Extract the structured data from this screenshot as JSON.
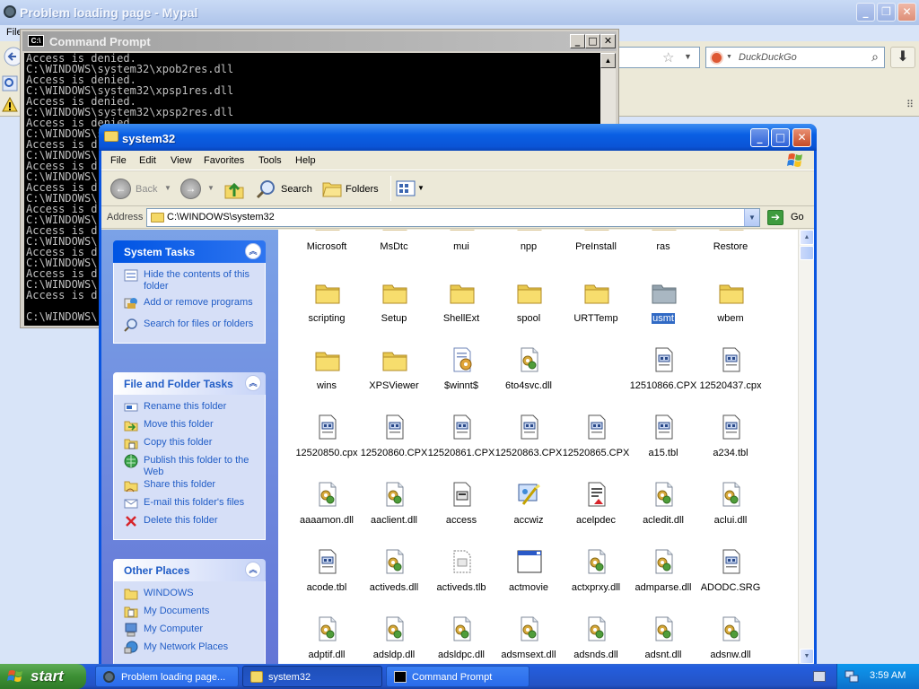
{
  "browser": {
    "title": "Problem loading page - Mypal",
    "menu_first": "File",
    "search_placeholder": "DuckDuckGo"
  },
  "cmd": {
    "title": "Command Prompt",
    "lines": [
      "Access is denied.",
      "C:\\WINDOWS\\system32\\xpob2res.dll",
      "Access is denied.",
      "C:\\WINDOWS\\system32\\xpsp1res.dll",
      "Access is denied.",
      "C:\\WINDOWS\\system32\\xpsp2res.dll",
      "Access is denied.",
      "C:\\WINDOWS\\system32\\",
      "Access is d",
      "C:\\WINDOWS\\",
      "Access is d",
      "C:\\WINDOWS\\",
      "Access is d",
      "C:\\WINDOWS\\",
      "Access is d",
      "C:\\WINDOWS\\",
      "Access is d",
      "C:\\WINDOWS\\",
      "Access is d",
      "C:\\WINDOWS\\",
      "Access is d",
      "C:\\WINDOWS\\",
      "Access is d",
      "",
      "C:\\WINDOWS\\"
    ]
  },
  "explorer": {
    "title": "system32",
    "menu": [
      "File",
      "Edit",
      "View",
      "Favorites",
      "Tools",
      "Help"
    ],
    "toolbar": {
      "back": "Back",
      "search": "Search",
      "folders": "Folders"
    },
    "address_label": "Address",
    "address_value": "C:\\WINDOWS\\system32",
    "go_label": "Go",
    "panels": {
      "system_tasks": {
        "title": "System Tasks",
        "items": [
          "Hide the contents of this folder",
          "Add or remove programs",
          "Search for files or folders"
        ]
      },
      "file_folder_tasks": {
        "title": "File and Folder Tasks",
        "items": [
          "Rename this folder",
          "Move this folder",
          "Copy this folder",
          "Publish this folder to the Web",
          "Share this folder",
          "E-mail this folder's files",
          "Delete this folder"
        ]
      },
      "other_places": {
        "title": "Other Places",
        "items": [
          "WINDOWS",
          "My Documents",
          "My Computer",
          "My Network Places"
        ]
      }
    },
    "files": [
      {
        "name": "Microsoft",
        "icon": "folder"
      },
      {
        "name": "MsDtc",
        "icon": "folder"
      },
      {
        "name": "mui",
        "icon": "folder"
      },
      {
        "name": "npp",
        "icon": "folder"
      },
      {
        "name": "PreInstall",
        "icon": "folder"
      },
      {
        "name": "ras",
        "icon": "folder"
      },
      {
        "name": "Restore",
        "icon": "folder"
      },
      {
        "name": "scripting",
        "icon": "folder"
      },
      {
        "name": "Setup",
        "icon": "folder"
      },
      {
        "name": "ShellExt",
        "icon": "folder"
      },
      {
        "name": "spool",
        "icon": "folder"
      },
      {
        "name": "URTTemp",
        "icon": "folder"
      },
      {
        "name": "usmt",
        "icon": "folder-hidden",
        "selected": true
      },
      {
        "name": "wbem",
        "icon": "folder"
      },
      {
        "name": "wins",
        "icon": "folder"
      },
      {
        "name": "XPSViewer",
        "icon": "folder"
      },
      {
        "name": "$winnt$",
        "icon": "config"
      },
      {
        "name": "6to4svc.dll",
        "icon": "dll"
      },
      {
        "name": "",
        "icon": "none"
      },
      {
        "name": "12510866.CPX",
        "icon": "cpx"
      },
      {
        "name": "12520437.cpx",
        "icon": "cpx"
      },
      {
        "name": "12520850.cpx",
        "icon": "cpx"
      },
      {
        "name": "12520860.CPX",
        "icon": "cpx"
      },
      {
        "name": "12520861.CPX",
        "icon": "cpx"
      },
      {
        "name": "12520863.CPX",
        "icon": "cpx"
      },
      {
        "name": "12520865.CPX",
        "icon": "cpx"
      },
      {
        "name": "a15.tbl",
        "icon": "cpx"
      },
      {
        "name": "a234.tbl",
        "icon": "cpx"
      },
      {
        "name": "aaaamon.dll",
        "icon": "dll"
      },
      {
        "name": "aaclient.dll",
        "icon": "dll"
      },
      {
        "name": "access",
        "icon": "cpl"
      },
      {
        "name": "accwiz",
        "icon": "wizard"
      },
      {
        "name": "acelpdec",
        "icon": "codec"
      },
      {
        "name": "acledit.dll",
        "icon": "dll"
      },
      {
        "name": "aclui.dll",
        "icon": "dll"
      },
      {
        "name": "acode.tbl",
        "icon": "cpx"
      },
      {
        "name": "activeds.dll",
        "icon": "dll"
      },
      {
        "name": "activeds.tlb",
        "icon": "tlb"
      },
      {
        "name": "actmovie",
        "icon": "window"
      },
      {
        "name": "actxprxy.dll",
        "icon": "dll"
      },
      {
        "name": "admparse.dll",
        "icon": "dll"
      },
      {
        "name": "ADODC.SRG",
        "icon": "cpx"
      },
      {
        "name": "adptif.dll",
        "icon": "dll"
      },
      {
        "name": "adsldp.dll",
        "icon": "dll"
      },
      {
        "name": "adsldpc.dll",
        "icon": "dll"
      },
      {
        "name": "adsmsext.dll",
        "icon": "dll"
      },
      {
        "name": "adsnds.dll",
        "icon": "dll"
      },
      {
        "name": "adsnt.dll",
        "icon": "dll"
      },
      {
        "name": "adsnw.dll",
        "icon": "dll"
      }
    ]
  },
  "taskbar": {
    "start": "start",
    "tasks": [
      "Problem loading page...",
      "system32",
      "Command Prompt"
    ],
    "clock": "3:59 AM"
  },
  "colors": {
    "xp_blue": "#0a55e0",
    "taskpane_link": "#215dc6",
    "selection": "#316ac5",
    "start_green": "#3c8f34"
  }
}
